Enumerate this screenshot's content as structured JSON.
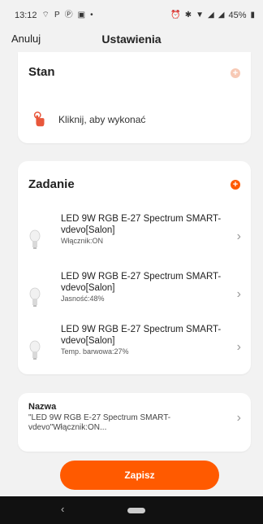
{
  "status_bar": {
    "time": "13:12",
    "left_icons": [
      "wifi-icon",
      "p-icon",
      "p-icon",
      "notification-icon",
      "signal-icon",
      "dot-icon"
    ],
    "battery_text": "45%"
  },
  "nav": {
    "cancel_label": "Anuluj",
    "title": "Ustawienia"
  },
  "state_section": {
    "title": "Stan",
    "add_icon_color": "#f7c9b5",
    "tap_action_text": "Kliknij, aby wykonać",
    "tap_icon_color": "#e8573b"
  },
  "task_section": {
    "title": "Zadanie",
    "add_icon_color": "#ff5a00",
    "items": [
      {
        "name": "LED 9W RGB E-27 Spectrum SMART-vdevo[Salon]",
        "status": "Włącznik:ON"
      },
      {
        "name": "LED 9W RGB E-27 Spectrum SMART-vdevo[Salon]",
        "status": "Jasność:48%"
      },
      {
        "name": "LED 9W RGB E-27 Spectrum SMART-vdevo[Salon]",
        "status": "Temp. barwowa:27%"
      }
    ]
  },
  "name_section": {
    "label": "Nazwa",
    "value": "\"LED 9W RGB E-27 Spectrum SMART-vdevo\"Włącznik:ON..."
  },
  "save_label": "Zapisz",
  "colors": {
    "accent": "#ff5a00",
    "background": "#f2f2f2",
    "card": "#ffffff"
  }
}
